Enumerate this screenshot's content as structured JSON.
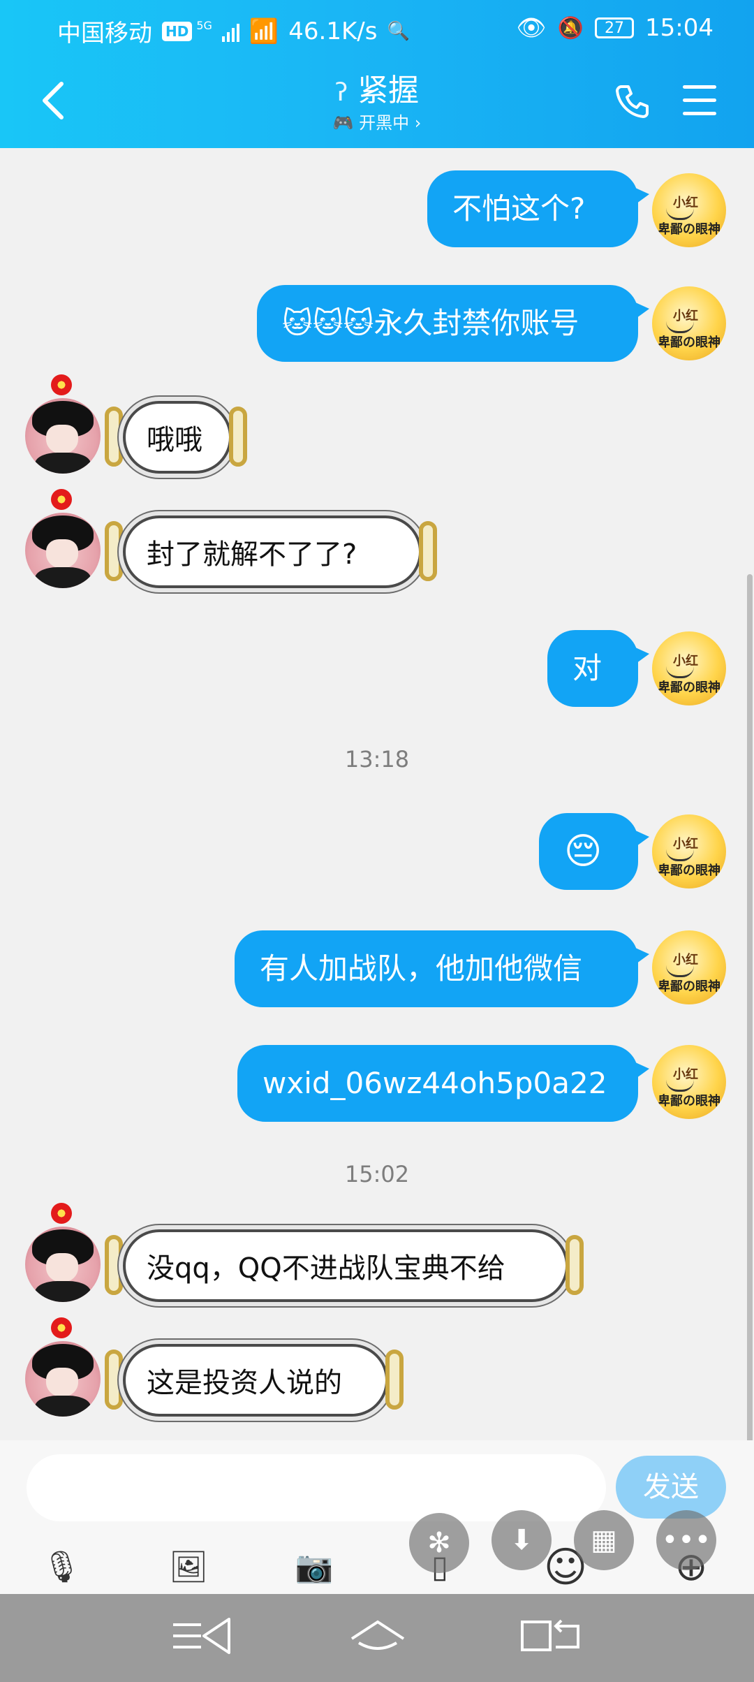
{
  "status_bar": {
    "carrier": "中国移动",
    "hd": "HD",
    "network": "5G",
    "speed": "46.1K/s",
    "battery": "27",
    "time": "15:04"
  },
  "header": {
    "title": "紧握",
    "subtitle": "开黑中 ›",
    "game_icon": "🎮"
  },
  "messages": [
    {
      "side": "right",
      "text": "不怕这个?"
    },
    {
      "side": "right",
      "text": "🐱🐱🐱永久封禁你账号"
    },
    {
      "side": "left",
      "text": "哦哦"
    },
    {
      "side": "left",
      "text": "封了就解不了了?"
    },
    {
      "side": "right",
      "text": "对"
    },
    {
      "side": "time",
      "text": "13:18"
    },
    {
      "side": "right",
      "text": "😔"
    },
    {
      "side": "right",
      "text": "有人加战队，他加他微信"
    },
    {
      "side": "right",
      "text": "wxid_06wz44oh5p0a22"
    },
    {
      "side": "time",
      "text": "15:02"
    },
    {
      "side": "left",
      "text": "没qq，QQ不进战队宝典不给"
    },
    {
      "side": "left",
      "text": "这是投资人说的"
    }
  ],
  "avatar_right": {
    "line1": "小红",
    "line2": "卑鄙の眼神"
  },
  "composer": {
    "placeholder": "",
    "send_label": "发送"
  },
  "icons": {
    "mic": "🎙",
    "image": "🖼",
    "camera": "📷",
    "emoji": "☺",
    "plus": "⊕"
  }
}
